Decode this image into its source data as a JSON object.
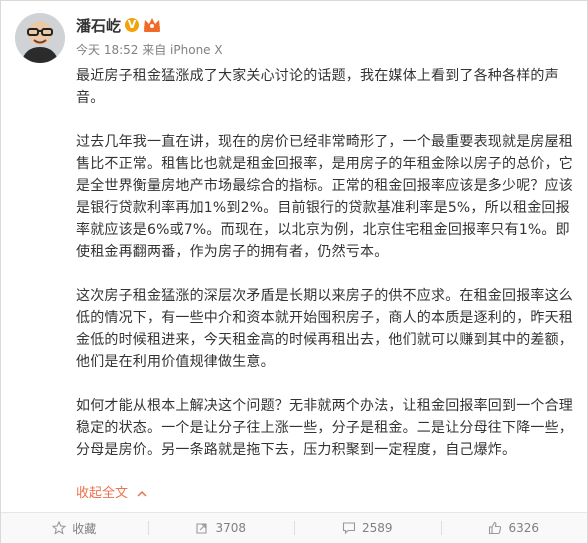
{
  "post": {
    "author": "潘石屹",
    "verified_badge": "V",
    "meta_time": "今天 18:52",
    "meta_source": "来自 iPhone X",
    "paragraphs": [
      "最近房子租金猛涨成了大家关心讨论的话题，我在媒体上看到了各种各样的声音。",
      "过去几年我一直在讲，现在的房价已经非常畸形了，一个最重要表现就是房屋租售比不正常。租售比也就是租金回报率，是用房子的年租金除以房子的总价，它是全世界衡量房地产市场最综合的指标。正常的租金回报率应该是多少呢？应该是银行贷款利率再加1%到2%。目前银行的贷款基准利率是5%，所以租金回报率就应该是6%或7%。而现在，以北京为例，北京住宅租金回报率只有1%。即使租金再翻两番，作为房子的拥有者，仍然亏本。",
      "这次房子租金猛涨的深层次矛盾是长期以来房子的供不应求。在租金回报率这么低的情况下，有一些中介和资本就开始囤积房子，商人的本质是逐利的，昨天租金低的时候租进来，今天租金高的时候再租出去，他们就可以赚到其中的差额，他们是在利用价值规律做生意。",
      "如何才能从根本上解决这个问题？无非就两个办法，让租金回报率回到一个合理稳定的状态。一个是让分子往上涨一些，分子是租金。二是让分母往下降一些，分母是房价。另一条路就是拖下去，压力积聚到一定程度，自己爆炸。"
    ],
    "collapse_label": "收起全文"
  },
  "toolbar": {
    "favorite_label": "收藏",
    "repost_count": "3708",
    "comment_count": "2589",
    "like_count": "6326"
  },
  "colors": {
    "accent": "#eb7350",
    "muted": "#808080",
    "badge": "#f0a30a",
    "text": "#333333"
  },
  "icons": [
    "avatar",
    "verified-v-icon",
    "vip-crown-icon",
    "chevron-up-icon",
    "star-icon",
    "repost-icon",
    "comment-icon",
    "thumbs-up-icon"
  ]
}
